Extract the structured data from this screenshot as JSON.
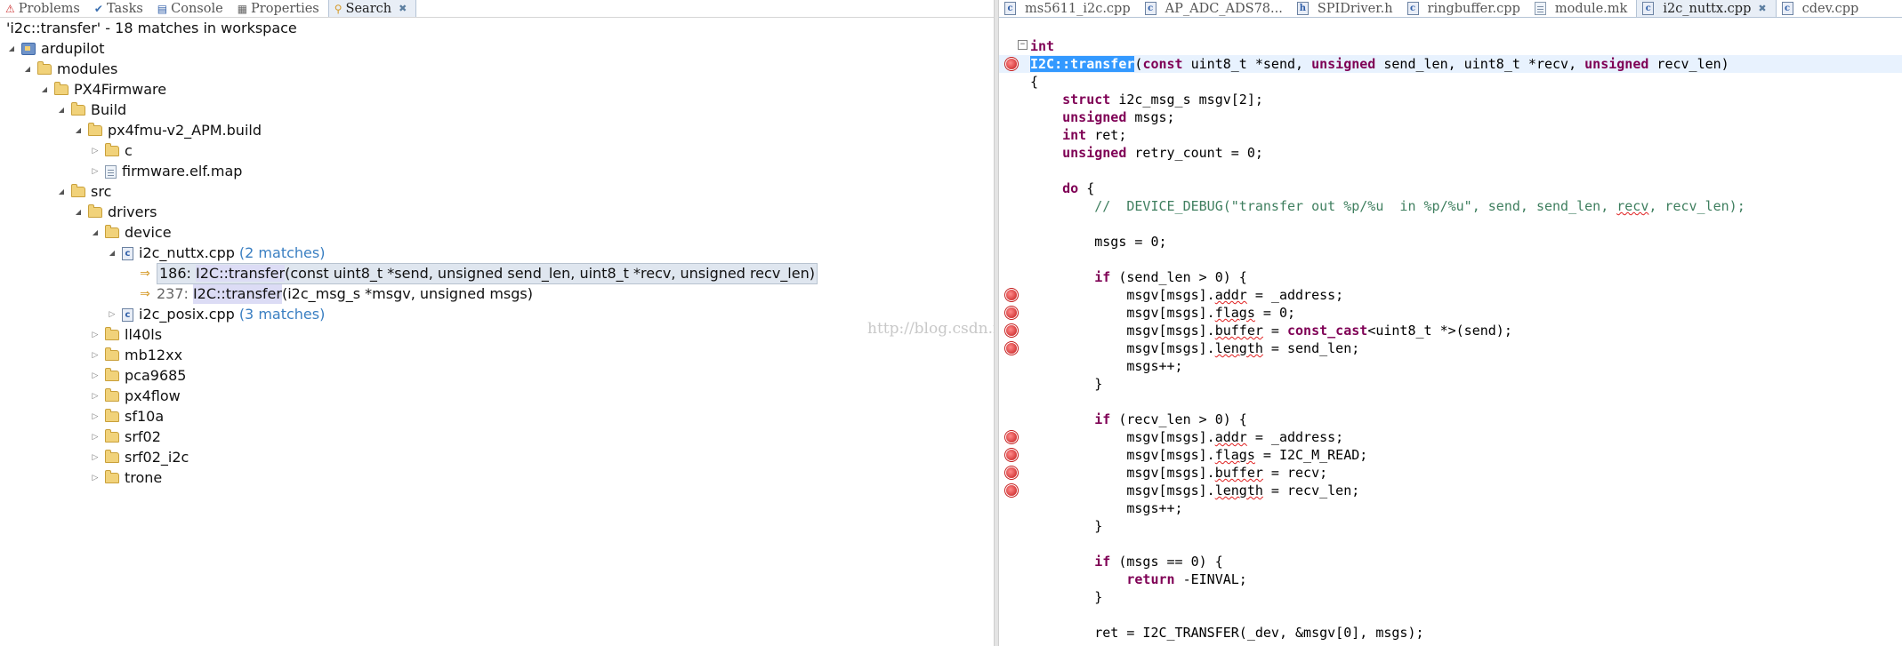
{
  "left_tabs": [
    {
      "label": "Problems"
    },
    {
      "label": "Tasks"
    },
    {
      "label": "Console"
    },
    {
      "label": "Properties"
    },
    {
      "label": "Search",
      "active": true
    }
  ],
  "search": {
    "title": "'i2c::transfer' - 18 matches in workspace"
  },
  "tree": {
    "ardupilot": "ardupilot",
    "modules": "modules",
    "px4firmware": "PX4Firmware",
    "build": "Build",
    "px4fmu": "px4fmu-v2_APM.build",
    "c": "c",
    "elfmap": "firmware.elf.map",
    "src": "src",
    "drivers": "drivers",
    "device": "device",
    "nuttx_file": "i2c_nuttx.cpp",
    "nuttx_matches": "(2 matches)",
    "m1_line": "186:",
    "m1_hit": "I2C::transfer",
    "m1_rest": "(const uint8_t *send, unsigned send_len, uint8_t *recv, unsigned recv_len)",
    "m2_line": "237:",
    "m2_hit": "I2C::transfer",
    "m2_rest": "(i2c_msg_s *msgv, unsigned msgs)",
    "posix_file": "i2c_posix.cpp",
    "posix_matches": "(3 matches)",
    "f_ll40ls": "ll40ls",
    "f_mb12xx": "mb12xx",
    "f_pca9685": "pca9685",
    "f_px4flow": "px4flow",
    "f_sf10a": "sf10a",
    "f_srf02": "srf02",
    "f_srf02i2c": "srf02_i2c",
    "f_trone": "trone"
  },
  "watermark": "http://blog.csdn.net/",
  "editor_tabs": [
    {
      "label": "ms5611_i2c.cpp"
    },
    {
      "label": "AP_ADC_ADS78..."
    },
    {
      "label": "SPIDriver.h"
    },
    {
      "label": "ringbuffer.cpp"
    },
    {
      "label": "module.mk"
    },
    {
      "label": "i2c_nuttx.cpp",
      "active": true
    },
    {
      "label": "cdev.cpp"
    }
  ],
  "code": {
    "l0": "int",
    "l1_sel": "I2C::transfer",
    "l1_a": "(",
    "l1_b": "const",
    "l1_c": " uint8_t *send, ",
    "l1_d": "unsigned",
    "l1_e": " send_len, uint8_t *recv, ",
    "l1_f": "unsigned",
    "l1_g": " recv_len)",
    "l2": "{",
    "l3_k": "struct",
    "l3_t": " i2c_msg_s msgv[2];",
    "l4_k": "unsigned",
    "l4_t": " msgs;",
    "l5_k": "int",
    "l5_t": " ret;",
    "l6_k": "unsigned",
    "l6_t": " retry_count = 0;",
    "l8_k": "do",
    "l8_t": " {",
    "l9_a": "//  DEVICE_DEBUG(\"transfer out %p/%u  in %p/%u\", send, send_len, ",
    "l9_b": "recv",
    "l9_c": ", recv_len);",
    "l11": "msgs = 0;",
    "l13_k": "if",
    "l13_t": " (send_len > 0) {",
    "l14_a": "msgv[msgs].",
    "l14_b": "addr",
    "l14_c": " = _address;",
    "l15_a": "msgv[msgs].",
    "l15_b": "flags",
    "l15_c": " = 0;",
    "l16_a": "msgv[msgs].",
    "l16_b": "buffer",
    "l16_c": " = ",
    "l16_d": "const_cast",
    "l16_e": "<uint8_t *>(send);",
    "l17_a": "msgv[msgs].",
    "l17_b": "length",
    "l17_c": " = send_len;",
    "l18": "msgs++;",
    "l19": "}",
    "l21_k": "if",
    "l21_t": " (recv_len > 0) {",
    "l22_a": "msgv[msgs].",
    "l22_b": "addr",
    "l22_c": " = _address;",
    "l23_a": "msgv[msgs].",
    "l23_b": "flags",
    "l23_c": " = I2C_M_READ;",
    "l24_a": "msgv[msgs].",
    "l24_b": "buffer",
    "l24_c": " = recv;",
    "l25_a": "msgv[msgs].",
    "l25_b": "length",
    "l25_c": " = recv_len;",
    "l26": "msgs++;",
    "l27": "}",
    "l29_k": "if",
    "l29_t": " (msgs == 0) {",
    "l30_k": "return",
    "l30_t": " -EINVAL;",
    "l31": "}",
    "l33": "ret = I2C_TRANSFER(_dev, &msgv[0], msgs);"
  }
}
